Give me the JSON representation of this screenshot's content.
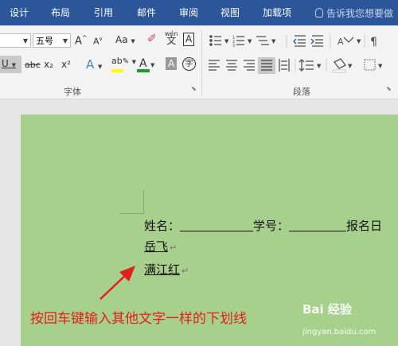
{
  "tabs": [
    "设计",
    "布局",
    "引用",
    "邮件",
    "审阅",
    "视图",
    "加载项"
  ],
  "tell_me": "告诉我您想要做",
  "ribbon": {
    "font_size": "五号",
    "font_group_label": "字体",
    "paragraph_group_label": "段落",
    "case_label": "Aa",
    "phonetic_top": "wén",
    "phonetic_bottom": "文",
    "char_border_label": "A",
    "enclose_label": "字",
    "strikethrough_label": "abc",
    "subscript_label": "x₂",
    "superscript_label": "x²",
    "text_effect_label": "A",
    "highlight_label": "ab",
    "font_color_label": "A",
    "shading_label": "A",
    "underline_label": "U",
    "grow_label": "A",
    "shrink_label": "A",
    "colors": {
      "highlight": "#ffff00",
      "font_color": "#1a9b2b"
    }
  },
  "document": {
    "line1": {
      "label1": "姓名：",
      "label2": "学号：",
      "label3": "报名日"
    },
    "line2": "岳飞",
    "line3": "满江红",
    "paragraph_mark": "↵"
  },
  "annotation": "按回车键输入其他文字一样的下划线",
  "watermark": {
    "brand": "Bai 经验",
    "url": "jingyan.baidu.com"
  }
}
